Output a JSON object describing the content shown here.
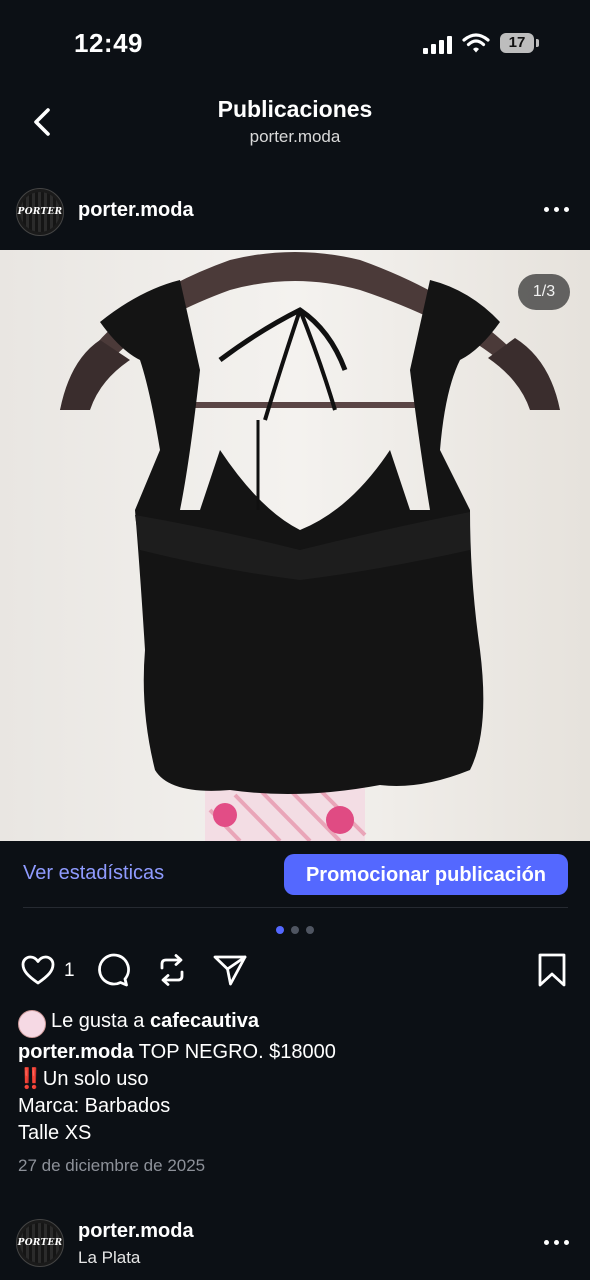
{
  "status_bar": {
    "time": "12:49",
    "battery": "17"
  },
  "header": {
    "title": "Publicaciones",
    "subtitle": "porter.moda"
  },
  "post": {
    "avatar_text": "PORTER",
    "username": "porter.moda",
    "image_counter": "1/3",
    "stats_link": "Ver estadísticas",
    "promote_button": "Promocionar publicación",
    "like_count": "1",
    "liked_by_prefix": "Le gusta a",
    "liked_by_user": "cafecautiva",
    "caption_user": "porter.moda",
    "caption_text": "TOP NEGRO. $18000",
    "caption_line2_mark": "‼️",
    "caption_line2": "Un solo uso",
    "caption_line3": "Marca: Barbados",
    "caption_line4": "Talle XS",
    "date": "27 de diciembre de 2025"
  },
  "next_post": {
    "avatar_text": "PORTER",
    "username": "porter.moda",
    "location": "La Plata"
  },
  "colors": {
    "background": "#0c1015",
    "accent": "#5468ff",
    "link": "#8f9bff",
    "active_dot": "#5468ff"
  },
  "icons": [
    "chevron-left-icon",
    "more-icon",
    "heart-icon",
    "comment-icon",
    "repost-icon",
    "send-icon",
    "bookmark-icon"
  ]
}
